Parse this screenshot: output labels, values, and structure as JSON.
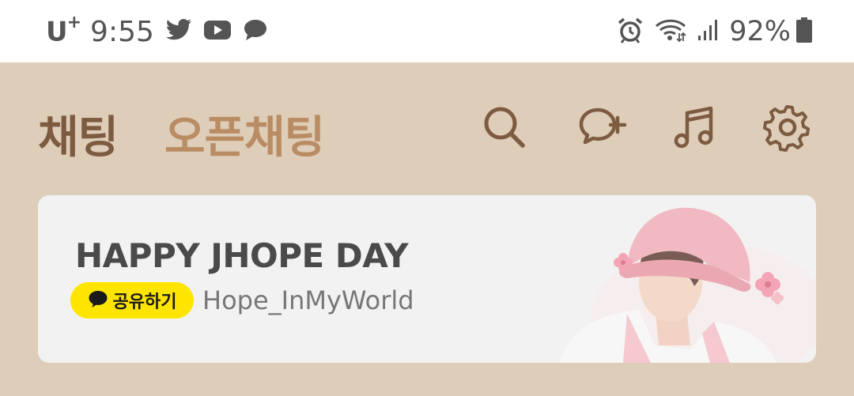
{
  "status_bar": {
    "carrier": "U",
    "carrier_sup": "+",
    "time": "9:55",
    "battery_percent": "92%",
    "notification_icons": [
      "twitter-icon",
      "youtube-icon",
      "chat-bubble-icon"
    ],
    "system_icons": [
      "alarm-icon",
      "wifi-icon",
      "signal-icon",
      "battery-icon"
    ]
  },
  "header": {
    "tabs": [
      {
        "label": "채팅",
        "active": true
      },
      {
        "label": "오픈채팅",
        "active": false
      }
    ],
    "actions": [
      "search-icon",
      "new-chat-icon",
      "music-icon",
      "settings-icon"
    ],
    "colors": {
      "background": "#decdb9",
      "active_tab": "#7d5b40",
      "inactive_tab": "#b98c63"
    }
  },
  "banner": {
    "title": "HAPPY JHOPE DAY",
    "share_label": "공유하기",
    "handle": "Hope_InMyWorld",
    "colors": {
      "card": "#f2f2f2",
      "share_button": "#fee500"
    }
  }
}
